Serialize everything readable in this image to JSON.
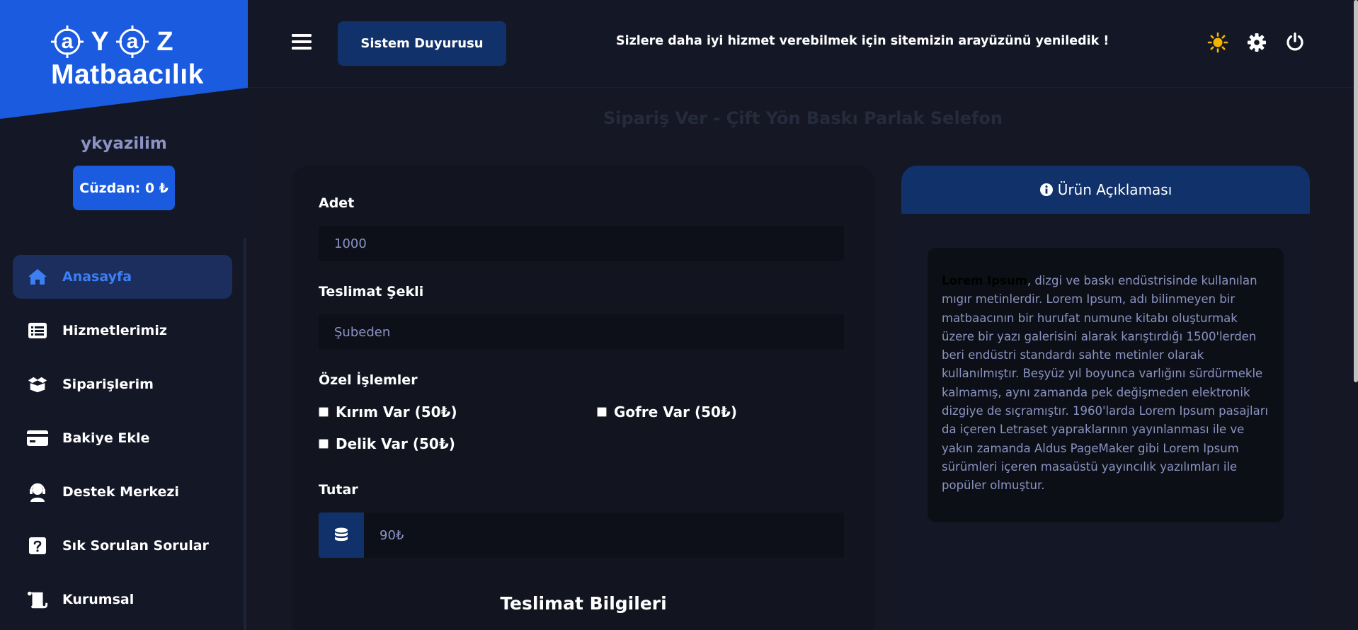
{
  "sidebar": {
    "logo": {
      "letters": [
        "a",
        "Y",
        "a",
        "Z"
      ],
      "subtitle": "Matbaacılık"
    },
    "username": "ykyazilim",
    "wallet_label": "Cüzdan: 0 ₺",
    "items": [
      {
        "label": "Anasayfa",
        "icon": "home-icon",
        "active": true
      },
      {
        "label": "Hizmetlerimiz",
        "icon": "list-icon",
        "active": false
      },
      {
        "label": "Siparişlerim",
        "icon": "box-icon",
        "active": false
      },
      {
        "label": "Bakiye Ekle",
        "icon": "credit-card-icon",
        "active": false
      },
      {
        "label": "Destek Merkezi",
        "icon": "headset-icon",
        "active": false
      },
      {
        "label": "Sık Sorulan Sorular",
        "icon": "question-icon",
        "active": false
      },
      {
        "label": "Kurumsal",
        "icon": "scroll-icon",
        "active": false
      }
    ]
  },
  "topbar": {
    "announce_label": "Sistem Duyurusu",
    "announce_text": "Sizlere daha iyi hizmet verebilmek için sitemizin arayüzünü yeniledik !"
  },
  "page": {
    "title": "Sipariş Ver - Çift Yön Baskı Parlak Selefon"
  },
  "order": {
    "quantity_label": "Adet",
    "quantity_value": "1000",
    "delivery_label": "Teslimat Şekli",
    "delivery_value": "Şubeden",
    "special_label": "Özel İşlemler",
    "options": [
      {
        "label": "Kırım Var (50₺)",
        "checked": false
      },
      {
        "label": "Gofre Var (50₺)",
        "checked": false
      },
      {
        "label": "Delik Var (50₺)",
        "checked": false
      }
    ],
    "amount_label": "Tutar",
    "amount_value": "90₺",
    "delivery_info_title": "Teslimat Bilgileri"
  },
  "description": {
    "header": "Ürün Açıklaması",
    "bold_lead": "Lorem Ipsum",
    "text": ", dizgi ve baskı endüstrisinde kullanılan mıgır metinlerdir. Lorem Ipsum, adı bilinmeyen bir matbaacının bir hurufat numune kitabı oluşturmak üzere bir yazı galerisini alarak karıştırdığı 1500'lerden beri endüstri standardı sahte metinler olarak kullanılmıştır. Beşyüz yıl boyunca varlığını sürdürmekle kalmamış, aynı zamanda pek değişmeden elektronik dizgiye de sıçramıştır. 1960'larda Lorem Ipsum pasajları da içeren Letraset yapraklarının yayınlanması ile ve yakın zamanda Aldus PageMaker gibi Lorem Ipsum sürümleri içeren masaüstü yayıncılık yazılımları ile popüler olmuştur."
  },
  "colors": {
    "accent": "#1a5be0",
    "navy": "#11316b",
    "background": "#151824",
    "sun": "#f5b400"
  }
}
